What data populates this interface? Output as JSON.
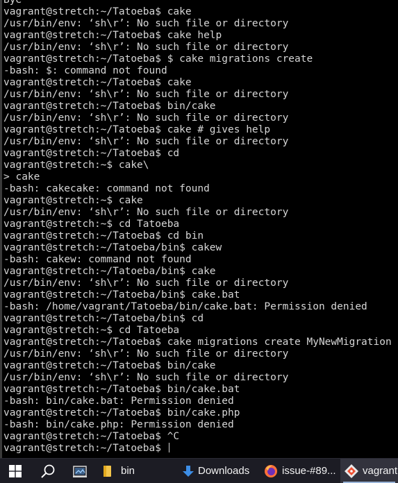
{
  "terminal": {
    "lines": [
      "Bye",
      "vagrant@stretch:~/Tatoeba$ cake",
      "/usr/bin/env: ‘sh\\r’: No such file or directory",
      "vagrant@stretch:~/Tatoeba$ cake help",
      "/usr/bin/env: ‘sh\\r’: No such file or directory",
      "vagrant@stretch:~/Tatoeba$ $ cake migrations create",
      "-bash: $: command not found",
      "vagrant@stretch:~/Tatoeba$ cake",
      "/usr/bin/env: ‘sh\\r’: No such file or directory",
      "vagrant@stretch:~/Tatoeba$ bin/cake",
      "/usr/bin/env: ‘sh\\r’: No such file or directory",
      "vagrant@stretch:~/Tatoeba$ cake # gives help",
      "/usr/bin/env: ‘sh\\r’: No such file or directory",
      "vagrant@stretch:~/Tatoeba$ cd",
      "vagrant@stretch:~$ cake\\",
      "> cake",
      "-bash: cakecake: command not found",
      "vagrant@stretch:~$ cake",
      "/usr/bin/env: ‘sh\\r’: No such file or directory",
      "vagrant@stretch:~$ cd Tatoeba",
      "vagrant@stretch:~/Tatoeba$ cd bin",
      "vagrant@stretch:~/Tatoeba/bin$ cakew",
      "-bash: cakew: command not found",
      "vagrant@stretch:~/Tatoeba/bin$ cake",
      "/usr/bin/env: ‘sh\\r’: No such file or directory",
      "vagrant@stretch:~/Tatoeba/bin$ cake.bat",
      "-bash: /home/vagrant/Tatoeba/bin/cake.bat: Permission denied",
      "vagrant@stretch:~/Tatoeba/bin$ cd",
      "vagrant@stretch:~$ cd Tatoeba",
      "vagrant@stretch:~/Tatoeba$ cake migrations create MyNewMigration",
      "/usr/bin/env: ‘sh\\r’: No such file or directory",
      "vagrant@stretch:~/Tatoeba$ bin/cake",
      "/usr/bin/env: ‘sh\\r’: No such file or directory",
      "vagrant@stretch:~/Tatoeba$ bin/cake.bat",
      "-bash: bin/cake.bat: Permission denied",
      "vagrant@stretch:~/Tatoeba$ bin/cake.php",
      "-bash: bin/cake.php: Permission denied",
      "vagrant@stretch:~/Tatoeba$ ^C"
    ],
    "prompt_line": "vagrant@stretch:~/Tatoeba$ ",
    "colors": {
      "background": "#000000",
      "foreground": "#d6d6d6"
    }
  },
  "taskbar": {
    "start": {
      "icon": "windows-logo-icon"
    },
    "search": {
      "icon": "search-icon"
    },
    "task_view": {
      "icon": "task-view-icon"
    },
    "items": [
      {
        "label": "bin",
        "icon": "folder-icon",
        "active": false
      },
      {
        "label": "Downloads",
        "icon": "download-arrow-icon",
        "active": false
      },
      {
        "label": "issue-#89...",
        "icon": "firefox-icon",
        "active": false
      },
      {
        "label": "vagrant",
        "icon": "git-bash-icon",
        "active": true
      }
    ],
    "colors": {
      "background": "#1c1c24",
      "active": "#33333d",
      "accent": "#9ab4d8"
    }
  }
}
